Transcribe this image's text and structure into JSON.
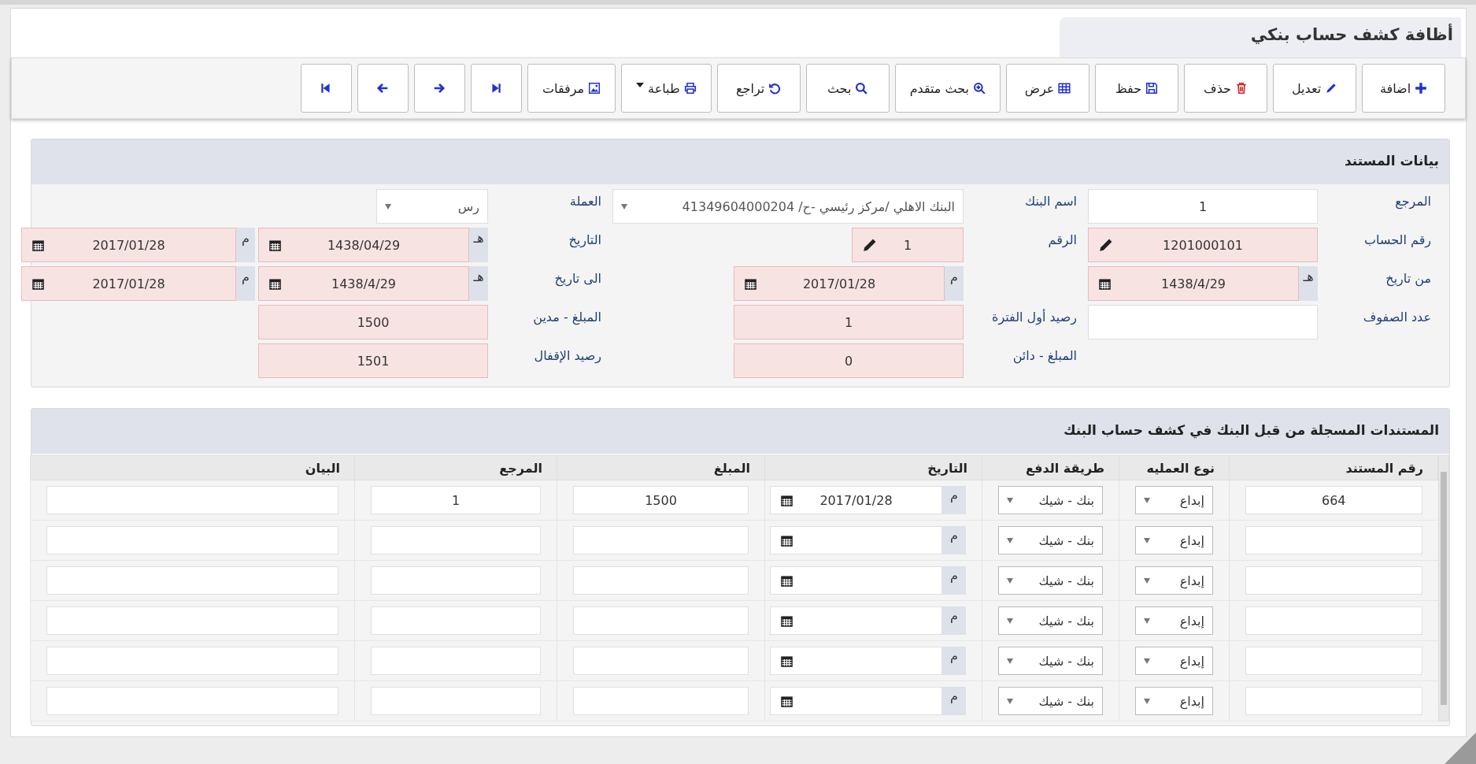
{
  "title": "أظافة كشف حساب بنكي",
  "toolbar": [
    {
      "kind": "add",
      "label": "اضافة"
    },
    {
      "kind": "edit",
      "label": "تعديل"
    },
    {
      "kind": "delete",
      "label": "حذف"
    },
    {
      "kind": "save",
      "label": "حفظ"
    },
    {
      "kind": "view",
      "label": "عرض"
    },
    {
      "kind": "advanced-search",
      "label": "بحث متقدم"
    },
    {
      "kind": "search",
      "label": "بحث"
    },
    {
      "kind": "undo",
      "label": "تراجع"
    },
    {
      "kind": "print",
      "label": "طباعة"
    },
    {
      "kind": "attachments",
      "label": "مرفقات"
    },
    {
      "kind": "last"
    },
    {
      "kind": "next"
    },
    {
      "kind": "previous"
    },
    {
      "kind": "first"
    }
  ],
  "document_section": {
    "title": "بيانات المستند",
    "fields": [
      {
        "label": "المرجع",
        "kind": "text",
        "value": "1",
        "required": false
      },
      {
        "label": "اسم البنك",
        "kind": "select",
        "value": "البنك الاهلي /مركز رئيسي -ح/ 41349604000204"
      },
      {
        "label": "العملة",
        "kind": "select",
        "value": "رس"
      },
      {
        "label": "رقم الحساب",
        "kind": "edit",
        "value": "1201000101",
        "required": true
      },
      {
        "label": "الرقم",
        "kind": "edit",
        "value": "1",
        "required": true
      },
      {
        "label": "التاريخ",
        "kind": "date-pair",
        "hijri_suffix": "هـ",
        "hijri": "1438/04/29",
        "gregorian_suffix": "م",
        "gregorian": "2017/01/28",
        "required": true
      },
      {
        "label": "من تاريخ",
        "kind": "date-pair",
        "hijri_suffix": "هـ",
        "hijri": "1438/4/29",
        "gregorian_suffix": "م",
        "gregorian": "2017/01/28",
        "required": true
      },
      {
        "label": "الى تاريخ",
        "kind": "date-pair",
        "hijri_suffix": "هـ",
        "hijri": "1438/4/29",
        "gregorian_suffix": "م",
        "gregorian": "2017/01/28",
        "required": true
      },
      {
        "label": "عدد الصفوف",
        "kind": "text",
        "required": false
      },
      {
        "label": "رصيد أول الفترة",
        "kind": "text",
        "value": "1",
        "required": true
      },
      {
        "label": "المبلغ - مدين",
        "kind": "text",
        "value": "1500",
        "required": true
      },
      {
        "label": "المبلغ - دائن",
        "kind": "text",
        "value": "0",
        "required": true
      },
      {
        "label": "رصيد الإقفال",
        "kind": "text",
        "value": "1501",
        "required": true
      }
    ]
  },
  "bank_entries": {
    "title": "المستندات المسجلة من قبل البنك في كشف حساب البنك",
    "columns": [
      {
        "label": "رقم المستند",
        "kind": "text"
      },
      {
        "label": "نوع العمليه",
        "kind": "select"
      },
      {
        "label": "طريقة الدفع",
        "kind": "select"
      },
      {
        "label": "التاريخ",
        "kind": "date"
      },
      {
        "label": "المبلغ",
        "kind": "text"
      },
      {
        "label": "المرجع",
        "kind": "text"
      },
      {
        "label": "البيان",
        "kind": "text"
      }
    ],
    "rows": [
      {
        "cells": [
          {
            "value": "664"
          },
          {
            "value": "إبداع"
          },
          {
            "value": "بنك - شيك"
          },
          {
            "suffix": "م",
            "value": "2017/01/28"
          },
          {
            "value": "1500"
          },
          {
            "value": "1"
          },
          {}
        ]
      },
      {
        "cells": [
          {},
          {
            "value": "إبداع"
          },
          {
            "value": "بنك - شيك"
          },
          {
            "suffix": "م"
          },
          {},
          {},
          {}
        ]
      },
      {
        "cells": [
          {},
          {
            "value": "إبداع"
          },
          {
            "value": "بنك - شيك"
          },
          {
            "suffix": "م"
          },
          {},
          {},
          {}
        ]
      },
      {
        "cells": [
          {},
          {
            "value": "إبداع"
          },
          {
            "value": "بنك - شيك"
          },
          {
            "suffix": "م"
          },
          {},
          {},
          {}
        ]
      },
      {
        "cells": [
          {},
          {
            "value": "إبداع"
          },
          {
            "value": "بنك - شيك"
          },
          {
            "suffix": "م"
          },
          {},
          {},
          {}
        ]
      },
      {
        "cells": [
          {},
          {
            "value": "إبداع"
          },
          {
            "value": "بنك - شيك"
          },
          {
            "suffix": "م"
          },
          {},
          {},
          {}
        ]
      }
    ]
  }
}
